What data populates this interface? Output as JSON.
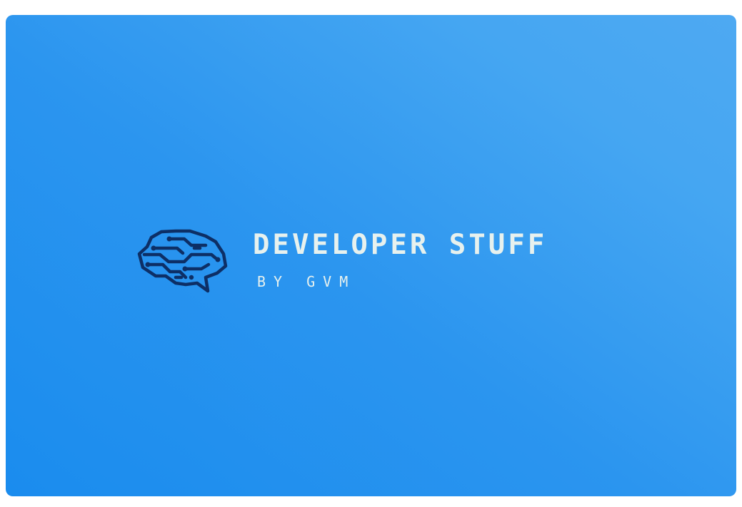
{
  "logo": {
    "icon": "brain-circuit-icon",
    "title": "DEVELOPER STUFF",
    "subtitle": "BY GVM"
  },
  "colors": {
    "background_start": "#1a8cee",
    "background_end": "#4ea9f2",
    "icon": "#0d2f66",
    "text": "#e7f1ee"
  }
}
